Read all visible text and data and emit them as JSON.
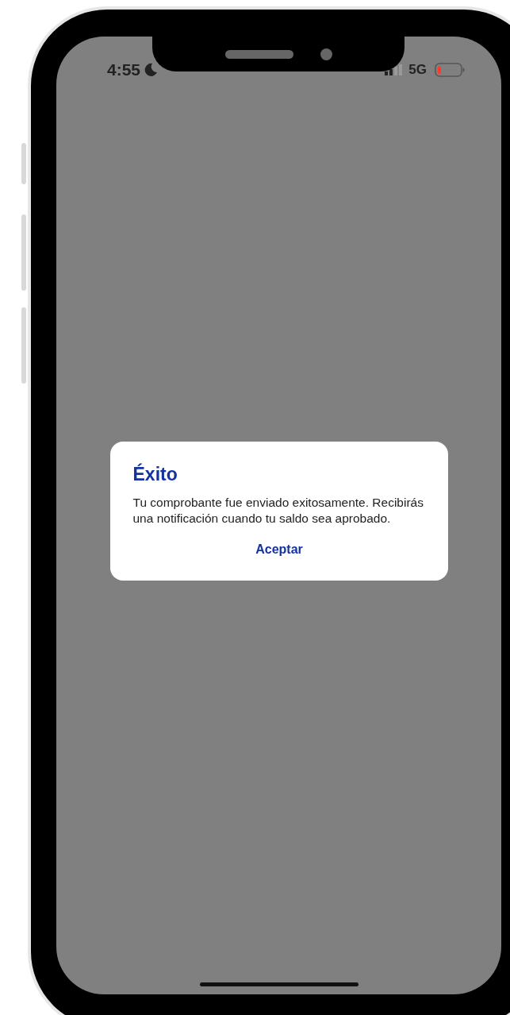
{
  "status_bar": {
    "time": "4:55",
    "network": "5G"
  },
  "dialog": {
    "title": "Éxito",
    "message": "Tu comprobante fue enviado exitosamente. Recibirás una notificación cuando tu saldo sea aprobado.",
    "buttons": [
      "Aceptar"
    ]
  }
}
